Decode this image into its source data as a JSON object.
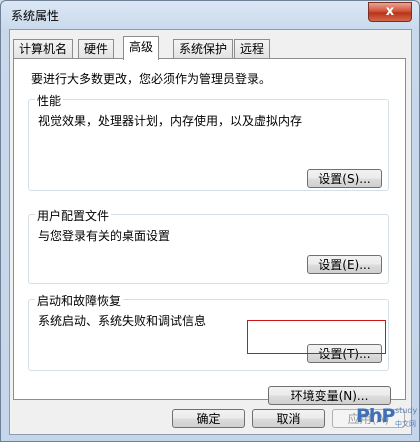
{
  "window": {
    "title": "系统属性",
    "close_glyph": "x"
  },
  "tabs": [
    {
      "label": "计算机名",
      "active": false
    },
    {
      "label": "硬件",
      "active": false
    },
    {
      "label": "高级",
      "active": true
    },
    {
      "label": "系统保护",
      "active": false
    },
    {
      "label": "远程",
      "active": false
    }
  ],
  "advanced": {
    "note": "要进行大多数更改，您必须作为管理员登录。",
    "performance": {
      "title": "性能",
      "description": "视觉效果，处理器计划，内存使用，以及虚拟内存",
      "button": "设置(S)..."
    },
    "user_profiles": {
      "title": "用户配置文件",
      "description": "与您登录有关的桌面设置",
      "button": "设置(E)..."
    },
    "startup_recovery": {
      "title": "启动和故障恢复",
      "description": "系统启动、系统失败和调试信息",
      "button": "设置(T)..."
    },
    "env_button": "环境变量(N)..."
  },
  "footer": {
    "ok": "确定",
    "cancel": "取消",
    "apply": "应用(A)"
  },
  "watermark": {
    "brand": "PhP",
    "sub": "study",
    "cn": "中文网"
  },
  "colors": {
    "highlight_box": "#c8161d",
    "close_button": "#c9452a",
    "watermark": "#3f6fb6"
  }
}
